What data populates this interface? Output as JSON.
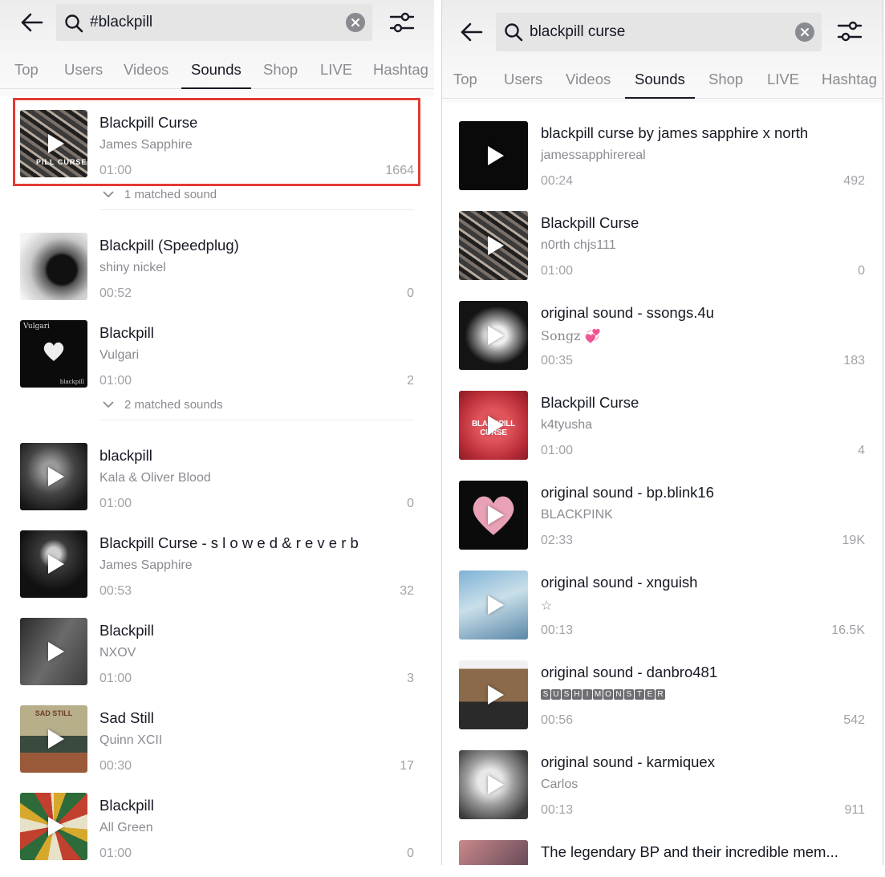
{
  "left": {
    "search_query": "#blackpill",
    "tabs": [
      "Top",
      "Users",
      "Videos",
      "Sounds",
      "Shop",
      "LIVE",
      "Hashtag"
    ],
    "active_tab": "Sounds",
    "items": [
      {
        "title": "Blackpill Curse",
        "artist": "James Sapphire",
        "duration": "01:00",
        "count": "1664"
      },
      {
        "title": "Blackpill (Speedplug)",
        "artist": "shiny nickel",
        "duration": "00:52",
        "count": "0"
      },
      {
        "title": "Blackpill",
        "artist": "Vulgari",
        "duration": "01:00",
        "count": "2"
      },
      {
        "title": "blackpill",
        "artist": "Kala & Oliver Blood",
        "duration": "01:00",
        "count": "0"
      },
      {
        "title": "Blackpill Curse - s l o w e d & r e v e r b",
        "artist": "James Sapphire",
        "duration": "00:53",
        "count": "32"
      },
      {
        "title": "Blackpill",
        "artist": "NXOV",
        "duration": "01:00",
        "count": "3"
      },
      {
        "title": "Sad Still",
        "artist": "Quinn XCII",
        "duration": "00:30",
        "count": "17"
      },
      {
        "title": "Blackpill",
        "artist": "All Green",
        "duration": "01:00",
        "count": "0"
      }
    ],
    "matched_1": "1 matched sound",
    "matched_2": "2 matched sounds",
    "thumb_text": {
      "vulgari": "Vulgari",
      "vulgari_small": "blackpill",
      "sadstill": "SAD STILL",
      "pillcurse": "PILL CURSE"
    }
  },
  "right": {
    "search_query": "blackpill curse",
    "tabs": [
      "Top",
      "Users",
      "Videos",
      "Sounds",
      "Shop",
      "LIVE",
      "Hashtag"
    ],
    "active_tab": "Sounds",
    "items": [
      {
        "title": "blackpill curse by james sapphire x north",
        "artist": "jamessapphirereal",
        "duration": "00:24",
        "count": "492"
      },
      {
        "title": "Blackpill Curse",
        "artist": "n0rth chjs111",
        "duration": "01:00",
        "count": "0"
      },
      {
        "title": "original sound - ssongs.4u",
        "artist": "Songz 💞",
        "duration": "00:35",
        "count": "183"
      },
      {
        "title": "Blackpill Curse",
        "artist": "k4tyusha",
        "duration": "01:00",
        "count": "4"
      },
      {
        "title": "original sound - bp.blink16",
        "artist": "BLACKPINK",
        "duration": "02:33",
        "count": "19K"
      },
      {
        "title": "original sound - xnguish",
        "artist": "☆",
        "duration": "00:13",
        "count": "16.5K"
      },
      {
        "title": "original sound - danbro481",
        "artist": "SUSHIMONSTER",
        "duration": "00:56",
        "count": "542"
      },
      {
        "title": "original sound - karmiquex",
        "artist": "Carlos",
        "duration": "00:13",
        "count": "911"
      },
      {
        "title": "The legendary BP and their incredible mem..."
      }
    ],
    "thumb_text": {
      "blackcurse": "BLACKPILL CURSE"
    }
  },
  "colors": {
    "highlight": "#e23b32",
    "text_primary": "#161823",
    "text_secondary": "#8a8b91"
  },
  "icons": [
    "back-arrow-icon",
    "search-icon",
    "clear-icon",
    "filter-sliders-icon",
    "play-icon",
    "chevron-down-icon"
  ]
}
